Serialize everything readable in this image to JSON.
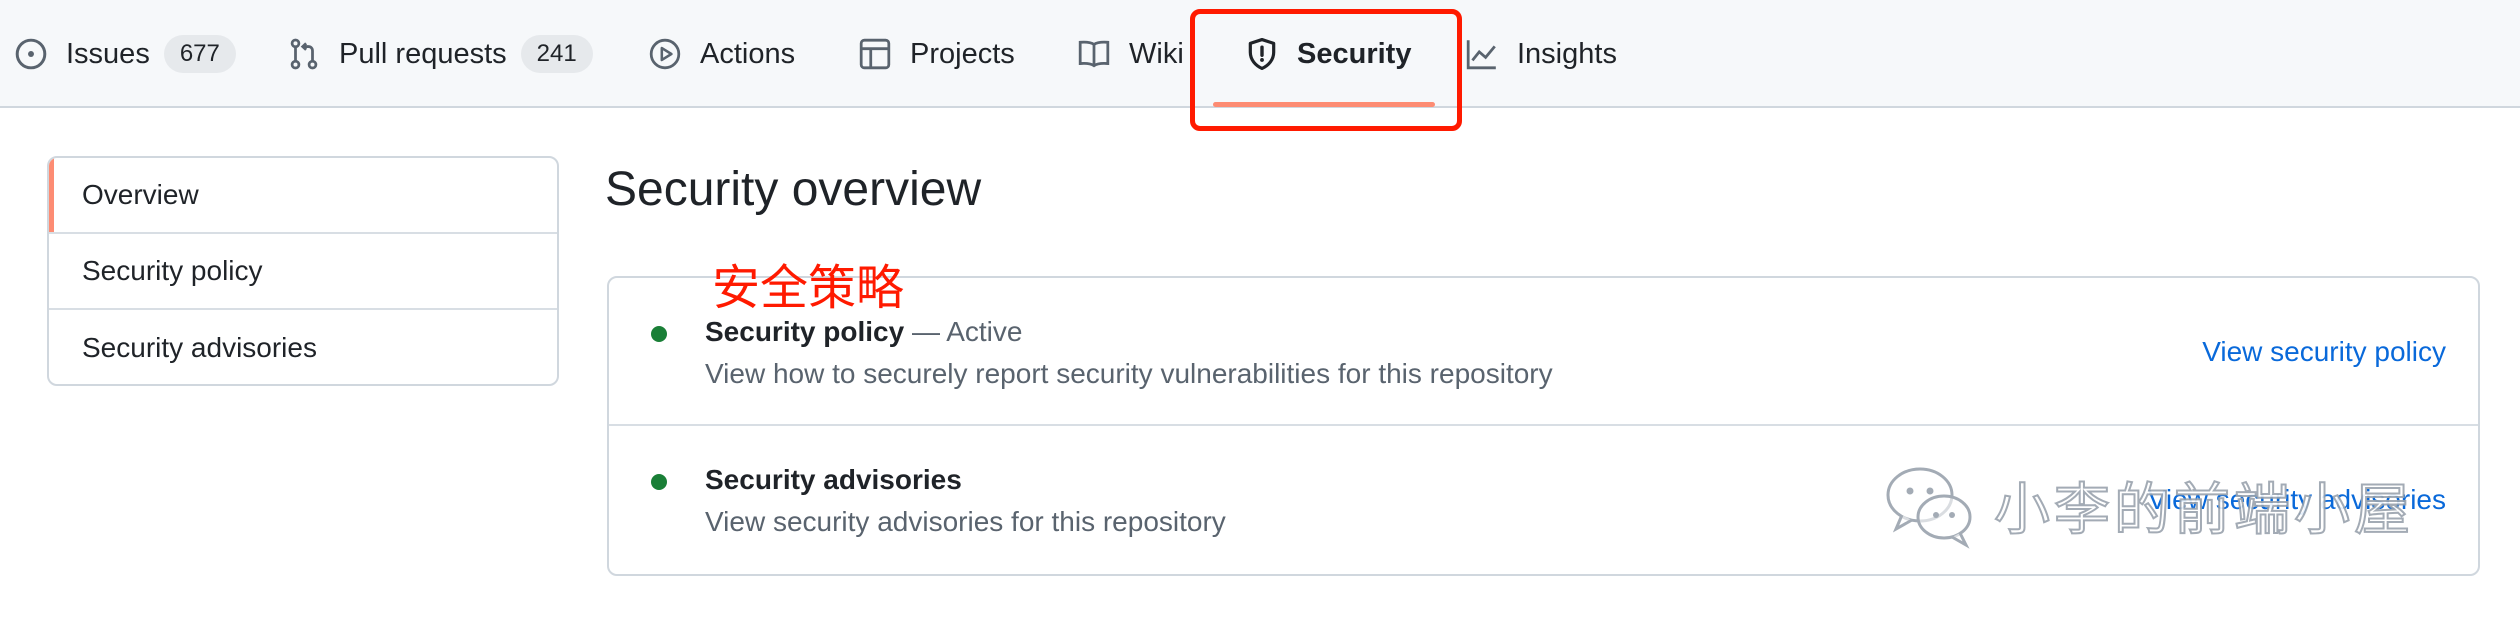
{
  "tabs": [
    {
      "label": "Issues",
      "count": "677",
      "icon": "issue-opened-icon"
    },
    {
      "label": "Pull requests",
      "count": "241",
      "icon": "git-pull-request-icon"
    },
    {
      "label": "Actions",
      "icon": "play-icon"
    },
    {
      "label": "Projects",
      "icon": "table-icon"
    },
    {
      "label": "Wiki",
      "icon": "book-icon"
    },
    {
      "label": "Security",
      "icon": "shield-icon",
      "selected": true
    },
    {
      "label": "Insights",
      "icon": "graph-icon"
    }
  ],
  "sidebar": {
    "items": [
      {
        "label": "Overview",
        "active": true
      },
      {
        "label": "Security policy"
      },
      {
        "label": "Security advisories"
      }
    ]
  },
  "main": {
    "title": "Security overview",
    "annotation": "安全策略",
    "rows": [
      {
        "title": "Security policy",
        "status": " — Active",
        "description": "View how to securely report security vulnerabilities for this repository",
        "link": "View security policy"
      },
      {
        "title": "Security advisories",
        "description": "View security advisories for this repository",
        "link": "View security advisories"
      }
    ]
  },
  "watermark": {
    "text": "小李的前端小屋",
    "icon": "wechat-icon"
  },
  "colors": {
    "accent_underline": "#fd8c73",
    "annotation_red": "#ff1a00",
    "link_blue": "#0969da",
    "status_green": "#1a7f37",
    "muted_text": "#59636e",
    "border": "#d0d7de"
  }
}
